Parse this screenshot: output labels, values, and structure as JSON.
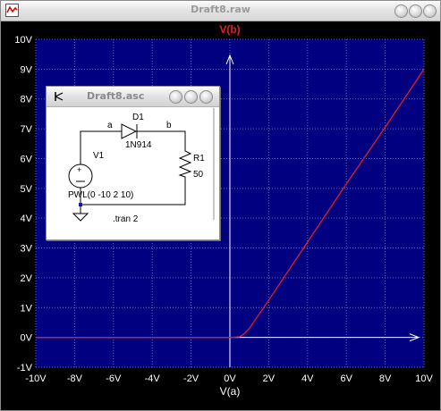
{
  "window": {
    "title": "Draft8.raw"
  },
  "schematic": {
    "title": "Draft8.asc",
    "labels": {
      "node_a": "a",
      "node_b": "b",
      "diode_ref": "D1",
      "diode_model": "1N914",
      "source_ref": "V1",
      "source_value": "PWL(0 -10 2 10)",
      "resistor_ref": "R1",
      "resistor_value": "50",
      "directive": ".tran 2"
    }
  },
  "colors": {
    "plot_bg": "#000080",
    "trace": "#e02020",
    "grid": "#6b6bb8",
    "axis_text": "#ffffff"
  },
  "chart_data": {
    "type": "line",
    "title": "V(b)",
    "xlabel": "V(a)",
    "ylabel": "",
    "xlim": [
      -10,
      10
    ],
    "ylim": [
      -1,
      10
    ],
    "x_ticks": [
      "-10V",
      "-8V",
      "-6V",
      "-4V",
      "-2V",
      "0V",
      "2V",
      "4V",
      "6V",
      "8V",
      "10V"
    ],
    "y_ticks": [
      "10V",
      "9V",
      "8V",
      "7V",
      "6V",
      "5V",
      "4V",
      "3V",
      "2V",
      "1V",
      "0V",
      "-1V"
    ],
    "grid": true,
    "series": [
      {
        "name": "V(b)",
        "color": "#e02020",
        "x": [
          -10,
          0,
          0.5,
          0.7,
          1.0,
          2.0,
          4.0,
          6.0,
          8.0,
          10.0
        ],
        "y": [
          0,
          0,
          0.02,
          0.1,
          0.3,
          1.25,
          3.2,
          5.15,
          7.05,
          9.0
        ]
      }
    ]
  }
}
